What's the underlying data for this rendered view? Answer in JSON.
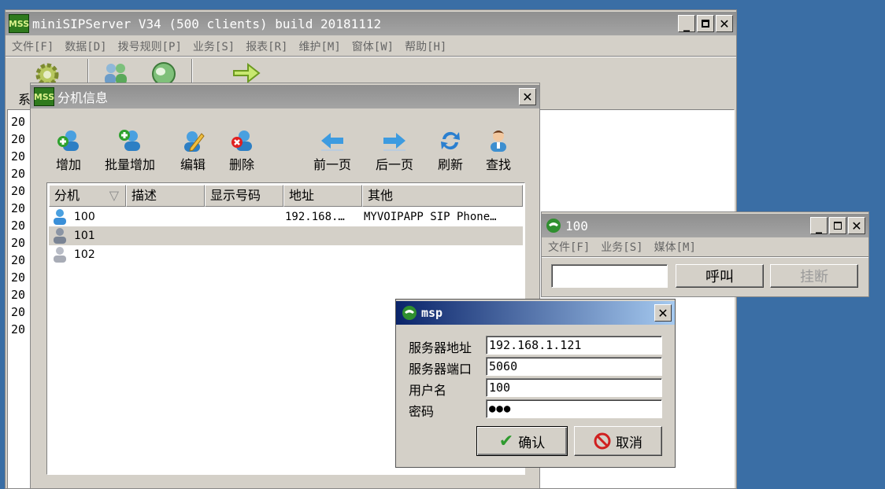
{
  "main_window": {
    "title": "miniSIPServer V34 (500 clients) build 20181112",
    "menu": [
      "文件[F]",
      "数据[D]",
      "拨号规则[P]",
      "业务[S]",
      "报表[R]",
      "维护[M]",
      "窗体[W]",
      "帮助[H]"
    ],
    "tab_partial": "系",
    "log_lines": [
      "20",
      "20",
      "20",
      "20",
      "20",
      "20",
      "20",
      "20",
      "20",
      "20",
      "20",
      "20",
      "20"
    ]
  },
  "ext_window": {
    "title": "分机信息",
    "toolbar": {
      "add": "增加",
      "batch_add": "批量增加",
      "edit": "编辑",
      "delete": "删除",
      "prev_page": "前一页",
      "next_page": "后一页",
      "refresh": "刷新",
      "find": "查找"
    },
    "columns": [
      "分机",
      "描述",
      "显示号码",
      "地址",
      "其他"
    ],
    "rows": [
      {
        "ext": "100",
        "desc": "",
        "display": "",
        "address": "192.168.…",
        "other": "MYVOIPAPP SIP Phone…"
      },
      {
        "ext": "101",
        "desc": "",
        "display": "",
        "address": "",
        "other": ""
      },
      {
        "ext": "102",
        "desc": "",
        "display": "",
        "address": "",
        "other": ""
      }
    ]
  },
  "phone_window": {
    "title": "100",
    "menu": [
      "文件[F]",
      "业务[S]",
      "媒体[M]"
    ],
    "dial_value": "",
    "call_label": "呼叫",
    "hangup_label": "挂断"
  },
  "msp_dialog": {
    "title": "msp",
    "server_addr_label": "服务器地址",
    "server_addr_value": "192.168.1.121",
    "server_port_label": "服务器端口",
    "server_port_value": "5060",
    "username_label": "用户名",
    "username_value": "100",
    "password_label": "密码",
    "password_value": "●●●",
    "ok_label": "确认",
    "cancel_label": "取消"
  },
  "colors": {
    "desktop": "#3a6ea5",
    "face": "#d4d0c8",
    "active_title_start": "#0a246a",
    "active_title_end": "#a6caf0",
    "selected_row": "#d4d0c8"
  }
}
